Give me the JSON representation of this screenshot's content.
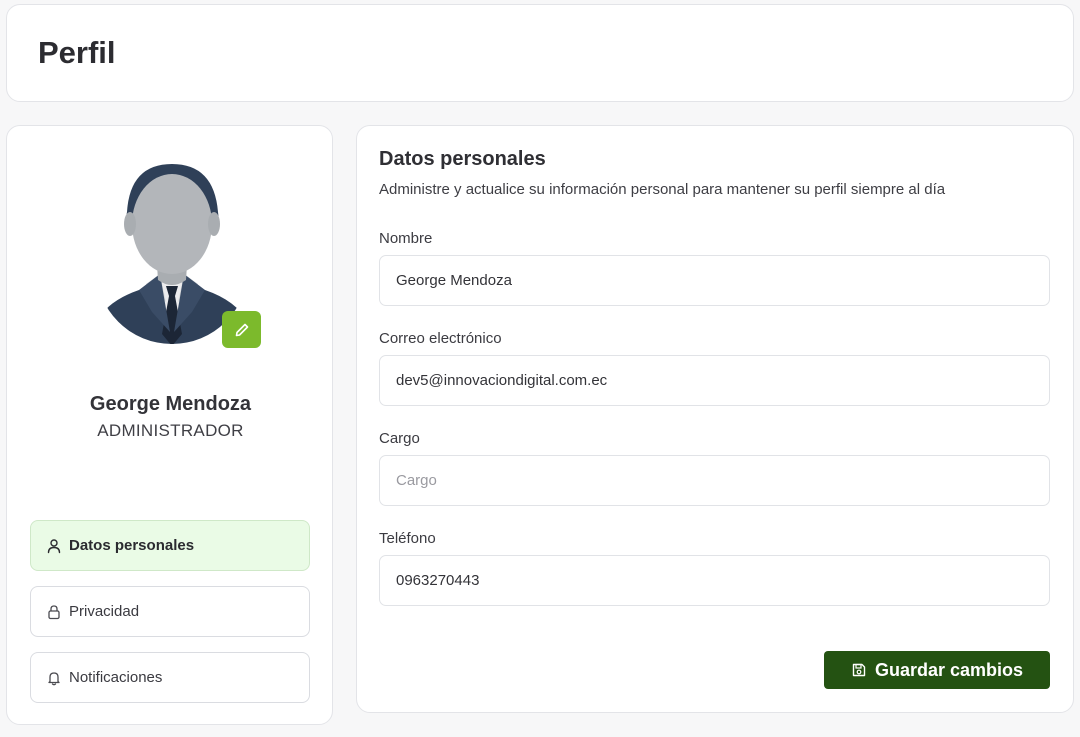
{
  "header": {
    "title": "Perfil"
  },
  "profile": {
    "name": "George Mendoza",
    "role": "ADMINISTRADOR",
    "nav": [
      {
        "label": "Datos personales",
        "icon": "user-icon",
        "active": true
      },
      {
        "label": "Privacidad",
        "icon": "lock-icon",
        "active": false
      },
      {
        "label": "Notificaciones",
        "icon": "bell-icon",
        "active": false
      }
    ]
  },
  "form": {
    "title": "Datos personales",
    "description": "Administre y actualice su información personal para mantener su perfil siempre al día",
    "fields": {
      "name": {
        "label": "Nombre",
        "value": "George Mendoza",
        "placeholder": ""
      },
      "email": {
        "label": "Correo electrónico",
        "value": "dev5@innovaciondigital.com.ec",
        "placeholder": ""
      },
      "position": {
        "label": "Cargo",
        "value": "",
        "placeholder": "Cargo"
      },
      "phone": {
        "label": "Teléfono",
        "value": "0963270443",
        "placeholder": ""
      }
    },
    "save_label": "Guardar cambios"
  },
  "colors": {
    "accent": "#245212",
    "edit_button": "#7cba2c",
    "active_nav_bg": "#eafbe6"
  }
}
